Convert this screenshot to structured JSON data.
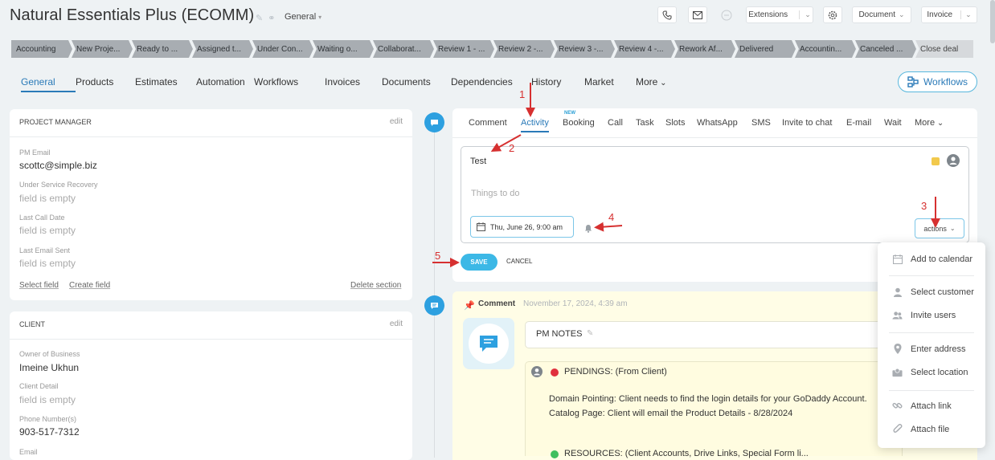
{
  "header": {
    "title": "Natural Essentials Plus (ECOMM)",
    "category": "General",
    "extensions_label": "Extensions",
    "document_label": "Document",
    "invoice_label": "Invoice"
  },
  "stages": [
    "Accounting",
    "New Proje...",
    "Ready to ...",
    "Assigned t...",
    "Under Con...",
    "Waiting o...",
    "Collaborat...",
    "Review 1 - ...",
    "Review 2 -...",
    "Review 3 -...",
    "Review 4 -...",
    "Rework Af...",
    "Delivered",
    "Accountin...",
    "Canceled ...",
    "Close deal"
  ],
  "tabs": [
    "General",
    "Products",
    "Estimates",
    "Automation",
    "Workflows",
    "Invoices",
    "Documents",
    "Dependencies",
    "History",
    "Market",
    "More"
  ],
  "workflows_button": "Workflows",
  "project_manager": {
    "title": "PROJECT MANAGER",
    "edit": "edit",
    "fields": [
      {
        "label": "PM Email",
        "value": "scottc@simple.biz",
        "empty": false
      },
      {
        "label": "Under Service Recovery",
        "value": "field is empty",
        "empty": true
      },
      {
        "label": "Last Call Date",
        "value": "field is empty",
        "empty": true
      },
      {
        "label": "Last Email Sent",
        "value": "field is empty",
        "empty": true
      }
    ],
    "select_field": "Select field",
    "create_field": "Create field",
    "delete_section": "Delete section"
  },
  "client": {
    "title": "CLIENT",
    "edit": "edit",
    "fields": [
      {
        "label": "Owner of Business",
        "value": "Imeine Ukhun",
        "empty": false
      },
      {
        "label": "Client Detail",
        "value": "field is empty",
        "empty": true
      },
      {
        "label": "Phone Number(s)",
        "value": "903-517-7312",
        "empty": false
      },
      {
        "label": "Email",
        "value": "",
        "empty": false
      }
    ]
  },
  "activity_tabs": [
    "Comment",
    "Activity",
    "Booking",
    "Call",
    "Task",
    "Slots",
    "WhatsApp",
    "SMS",
    "Invite to chat",
    "E-mail",
    "Wait",
    "More"
  ],
  "booking_badge": "NEW",
  "editor": {
    "title_value": "Test",
    "body_placeholder": "Things to do",
    "date": "Thu, June 26, 9:00 am",
    "actions_label": "actions",
    "save_label": "SAVE",
    "cancel_label": "CANCEL"
  },
  "annotations": [
    "1",
    "2",
    "3",
    "4",
    "5"
  ],
  "comment": {
    "type": "Comment",
    "timestamp": "November 17, 2024, 4:39 am",
    "notes_title": "PM NOTES",
    "pendings_title": "PENDINGS: (From Client)",
    "line1": "Domain Pointing: Client needs to find the login details for your GoDaddy Account.",
    "line2": "Catalog Page: Client will email the Product Details - 8/28/2024",
    "resources": "RESOURCES: (Client Accounts, Drive Links, Special Form li..."
  },
  "actions_menu": [
    "Add to calendar",
    "Select customer",
    "Invite users",
    "Enter address",
    "Select location",
    "Attach link",
    "Attach file"
  ],
  "colors": {
    "accent": "#2a7ab8",
    "save": "#3cb8e6",
    "stage": "#a8adb2",
    "annotation": "#d63030"
  }
}
